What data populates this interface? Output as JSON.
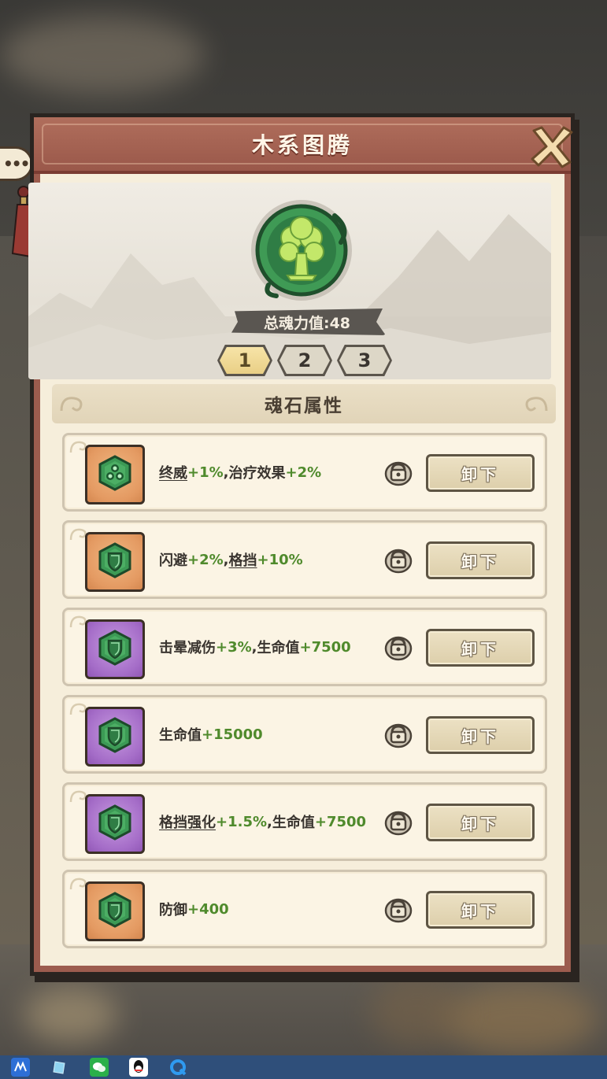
{
  "window": {
    "title": "木系图腾"
  },
  "totem": {
    "power_label": "总魂力值:48",
    "icon": "tree-emblem-icon",
    "accent": "#3f9a55"
  },
  "tabs": [
    {
      "label": "1",
      "active": true
    },
    {
      "label": "2",
      "active": false
    },
    {
      "label": "3",
      "active": false
    }
  ],
  "section": {
    "title": "魂石属性"
  },
  "stones": [
    {
      "frame": "orange",
      "icon": "triple-leaf-gem-icon",
      "parts": [
        {
          "t": "终威",
          "s": "u"
        },
        {
          "t": "+1%",
          "s": "g"
        },
        {
          "t": ",",
          "s": ""
        },
        {
          "t": "治疗效果",
          "s": ""
        },
        {
          "t": "+2%",
          "s": "g"
        }
      ],
      "button": "卸下"
    },
    {
      "frame": "orange",
      "icon": "shield-gem-icon",
      "parts": [
        {
          "t": "闪避",
          "s": ""
        },
        {
          "t": "+2%",
          "s": "g"
        },
        {
          "t": ",",
          "s": ""
        },
        {
          "t": "格挡",
          "s": "u"
        },
        {
          "t": "+10%",
          "s": "g"
        }
      ],
      "button": "卸下"
    },
    {
      "frame": "purple",
      "icon": "shield-gem-icon",
      "parts": [
        {
          "t": "击晕减伤",
          "s": ""
        },
        {
          "t": "+3%",
          "s": "g"
        },
        {
          "t": ",",
          "s": ""
        },
        {
          "t": "生命值",
          "s": ""
        },
        {
          "t": "+7500",
          "s": "g"
        }
      ],
      "button": "卸下"
    },
    {
      "frame": "purple",
      "icon": "shield-gem-icon",
      "parts": [
        {
          "t": "生命值",
          "s": ""
        },
        {
          "t": "+15000",
          "s": "g"
        }
      ],
      "button": "卸下"
    },
    {
      "frame": "purple",
      "icon": "shield-gem-icon",
      "parts": [
        {
          "t": "格挡强化",
          "s": "u"
        },
        {
          "t": "+1.5%",
          "s": "g"
        },
        {
          "t": ",",
          "s": ""
        },
        {
          "t": "生命值",
          "s": ""
        },
        {
          "t": "+7500",
          "s": "g"
        }
      ],
      "button": "卸下"
    },
    {
      "frame": "orange",
      "icon": "shield-gem-icon",
      "parts": [
        {
          "t": "防御",
          "s": ""
        },
        {
          "t": "+400",
          "s": "g"
        }
      ],
      "button": "卸下"
    }
  ],
  "taskbar": {
    "icons": [
      "app-launcher-icon",
      "notes-icon",
      "wechat-icon",
      "qq-icon",
      "browser-icon"
    ]
  }
}
